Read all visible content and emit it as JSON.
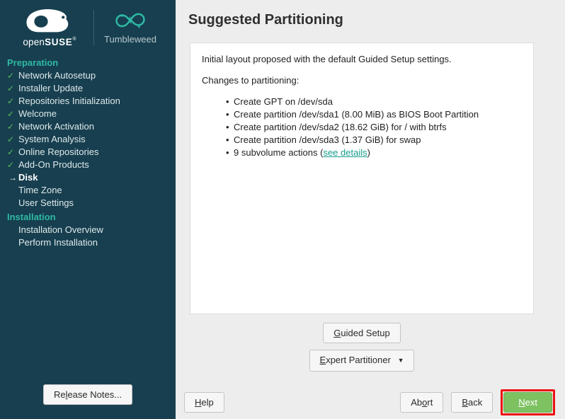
{
  "branding": {
    "suse_open": "open",
    "suse_bold": "SUSE",
    "suse_reg": "®",
    "product": "Tumbleweed",
    "chameleon_icon": "opensuse-chameleon-logo",
    "infinity_icon": "tumbleweed-infinity-icon"
  },
  "sidebar": {
    "sections": [
      {
        "label": "Preparation",
        "items": [
          {
            "label": "Network Autosetup",
            "state": "done"
          },
          {
            "label": "Installer Update",
            "state": "done"
          },
          {
            "label": "Repositories Initialization",
            "state": "done"
          },
          {
            "label": "Welcome",
            "state": "done"
          },
          {
            "label": "Network Activation",
            "state": "done"
          },
          {
            "label": "System Analysis",
            "state": "done"
          },
          {
            "label": "Online Repositories",
            "state": "done"
          },
          {
            "label": "Add-On Products",
            "state": "done"
          },
          {
            "label": "Disk",
            "state": "current"
          },
          {
            "label": "Time Zone",
            "state": "pending"
          },
          {
            "label": "User Settings",
            "state": "pending"
          }
        ]
      },
      {
        "label": "Installation",
        "items": [
          {
            "label": "Installation Overview",
            "state": "pending"
          },
          {
            "label": "Perform Installation",
            "state": "pending"
          }
        ]
      }
    ],
    "release_notes_label": "Release Notes...",
    "release_notes_accel": "l"
  },
  "main": {
    "title": "Suggested Partitioning",
    "intro": "Initial layout proposed with the default Guided Setup settings.",
    "changes_heading": "Changes to partitioning:",
    "actions": [
      {
        "text": "Create GPT on /dev/sda"
      },
      {
        "text": "Create partition /dev/sda1 (8.00 MiB) as BIOS Boot Partition"
      },
      {
        "text": "Create partition /dev/sda2 (18.62 GiB) for / with btrfs"
      },
      {
        "text": "Create partition /dev/sda3 (1.37 GiB) for swap"
      },
      {
        "text": "9 subvolume actions (",
        "link": "see details",
        "text_after": ")"
      }
    ],
    "guided_setup_label": "Guided Setup",
    "guided_setup_accel": "G",
    "expert_partitioner_label": "Expert Partitioner",
    "expert_partitioner_accel": "E",
    "expert_caret": "▼"
  },
  "bottom": {
    "help_label": "Help",
    "help_accel": "H",
    "abort_label": "Abort",
    "abort_accel": "o",
    "back_label": "Back",
    "back_accel": "B",
    "next_label": "Next",
    "next_accel": "N"
  },
  "colors": {
    "sidebar_bg": "#173f4f",
    "section_teal": "#2fb9a4",
    "check_green": "#5bbd5b",
    "link_teal": "#179e8c",
    "next_green": "#7dc161",
    "highlight_red": "#ee1111",
    "page_bg": "#ededed"
  }
}
